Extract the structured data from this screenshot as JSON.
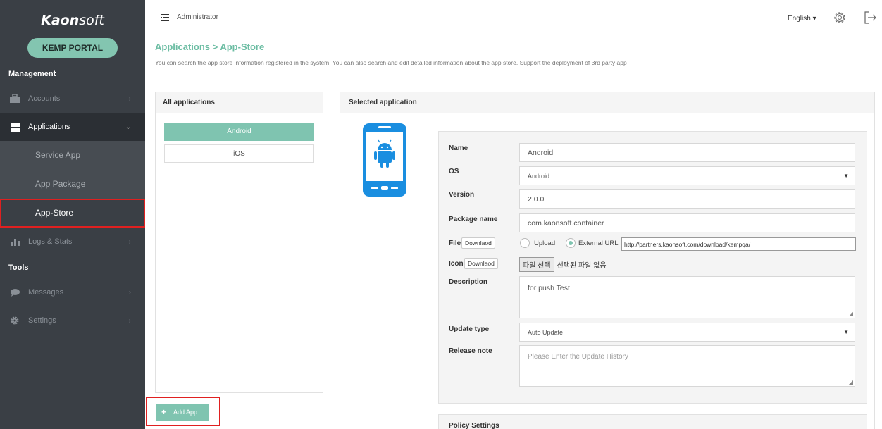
{
  "sidebar": {
    "logo_bold": "Kaon",
    "logo_light": "soft",
    "portal_label": "KEMP PORTAL",
    "section_management": "Management",
    "section_tools": "Tools",
    "items": [
      {
        "label": "Accounts",
        "icon": "briefcase-icon"
      },
      {
        "label": "Applications",
        "icon": "grid-icon"
      },
      {
        "label": "Logs & Stats",
        "icon": "bar-chart-icon"
      },
      {
        "label": "Messages",
        "icon": "chat-icon"
      },
      {
        "label": "Settings",
        "icon": "gear-icon"
      }
    ],
    "sub_items": [
      {
        "label": "Service App"
      },
      {
        "label": "App Package"
      },
      {
        "label": "App-Store"
      }
    ]
  },
  "topbar": {
    "user": "Administrator",
    "language": "English ▾"
  },
  "page": {
    "title": "Applications > App-Store",
    "description": "You can search the app store information registered in the system. You can also search and edit detailed information about the app store. Support the deployment of 3rd party app"
  },
  "left_panel": {
    "header": "All applications",
    "items": [
      "Android",
      "iOS"
    ],
    "add_button": "Add App"
  },
  "right_panel": {
    "header": "Selected application",
    "labels": {
      "name": "Name",
      "os": "OS",
      "version": "Version",
      "package": "Package name",
      "file": "File",
      "icon": "Icon",
      "description": "Description",
      "update_type": "Update type",
      "release_note": "Release note"
    },
    "values": {
      "name": "Android",
      "os": "Android",
      "version": "2.0.0",
      "package": "com.kaonsoft.container",
      "description": "for push Test",
      "update_type": "Auto Update",
      "release_note_placeholder": "Please Enter the Update History",
      "external_url": "http://partners.kaonsoft.com/download/kempqa/"
    },
    "download_label": "Downlaod",
    "upload_label": "Upload",
    "external_label": "External URL",
    "choose_file": "파일 선택",
    "no_file": "선택된 파일 없음",
    "policy_header": "Policy Settings"
  },
  "colors": {
    "accent": "#7fc4b0",
    "sidebar_bg": "#3a3f45",
    "highlight": "#e02020"
  }
}
